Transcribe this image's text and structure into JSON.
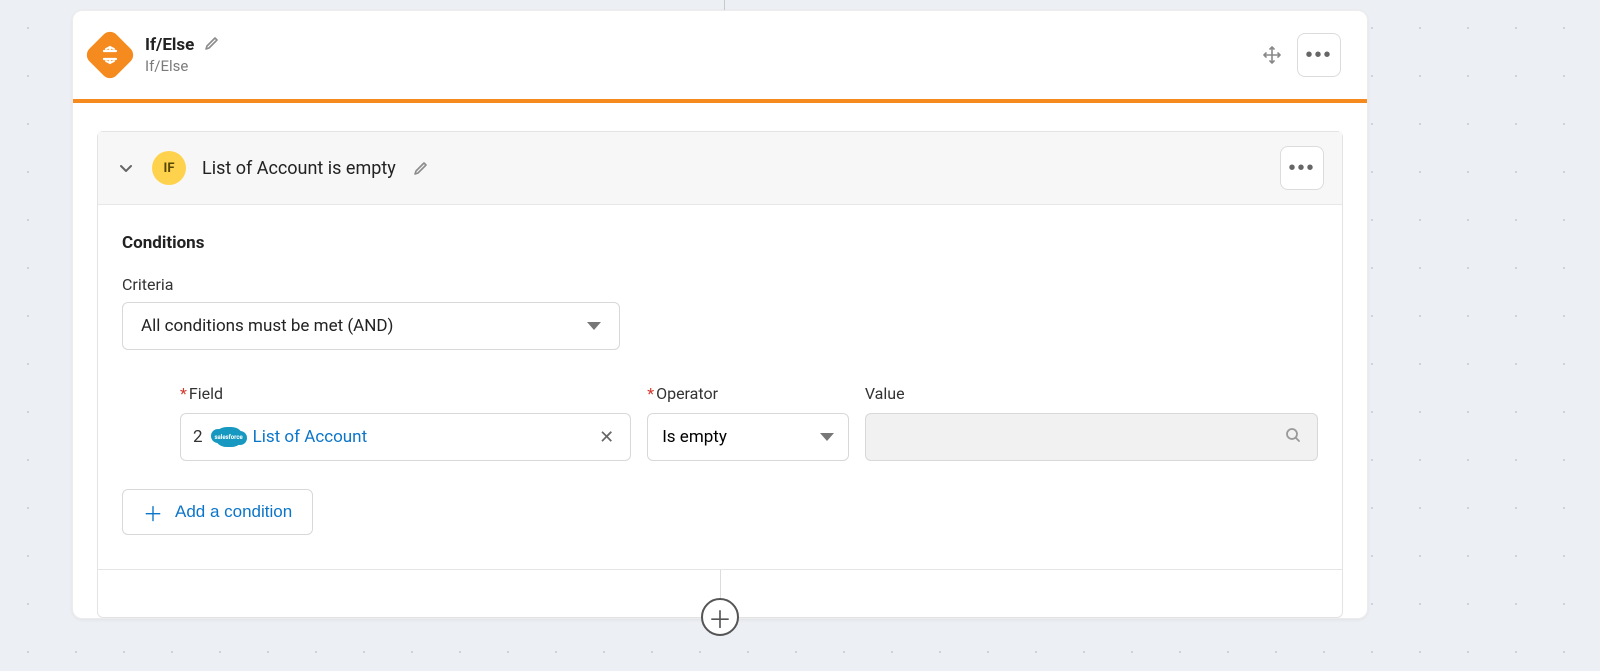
{
  "node": {
    "title": "If/Else",
    "subtitle": "If/Else"
  },
  "branch": {
    "badge": "IF",
    "title": "List of Account is empty"
  },
  "body": {
    "conditions_heading": "Conditions",
    "criteria_label": "Criteria",
    "criteria_value": "All conditions must be met (AND)",
    "labels": {
      "field": "Field",
      "operator": "Operator",
      "value": "Value"
    },
    "row": {
      "step_index": "2",
      "source_badge": "salesforce",
      "field_text": "List of Account",
      "operator": "Is empty",
      "value": ""
    },
    "add_condition": "Add a condition"
  }
}
